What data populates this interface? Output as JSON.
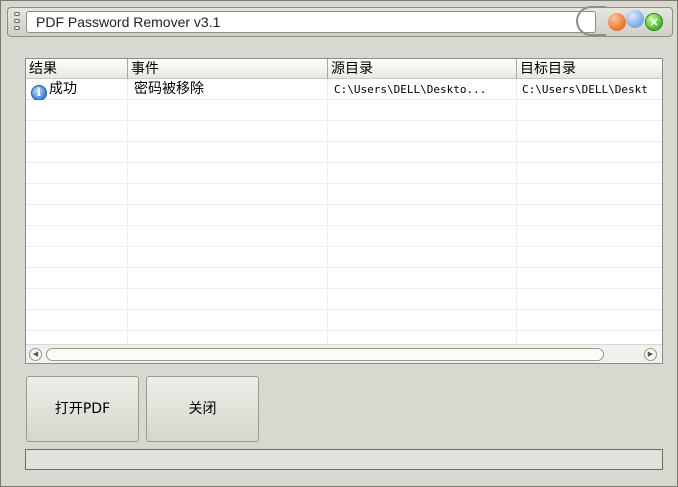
{
  "window": {
    "title": "PDF Password Remover v3.1"
  },
  "list": {
    "columns": [
      "结果",
      "事件",
      "源目录",
      "目标目录"
    ],
    "rows": [
      {
        "result": "成功",
        "event": "密码被移除",
        "source": "C:\\Users\\DELL\\Deskto...",
        "target": "C:\\Users\\DELL\\Deskt"
      }
    ]
  },
  "buttons": {
    "open_label": "打开PDF",
    "close_label": "关闭"
  },
  "icons": {
    "result_icon": "info-icon",
    "window_close": "close-icon",
    "window_min": "minimize-icon",
    "window_max": "maximize-icon"
  },
  "status": {
    "text": ""
  }
}
